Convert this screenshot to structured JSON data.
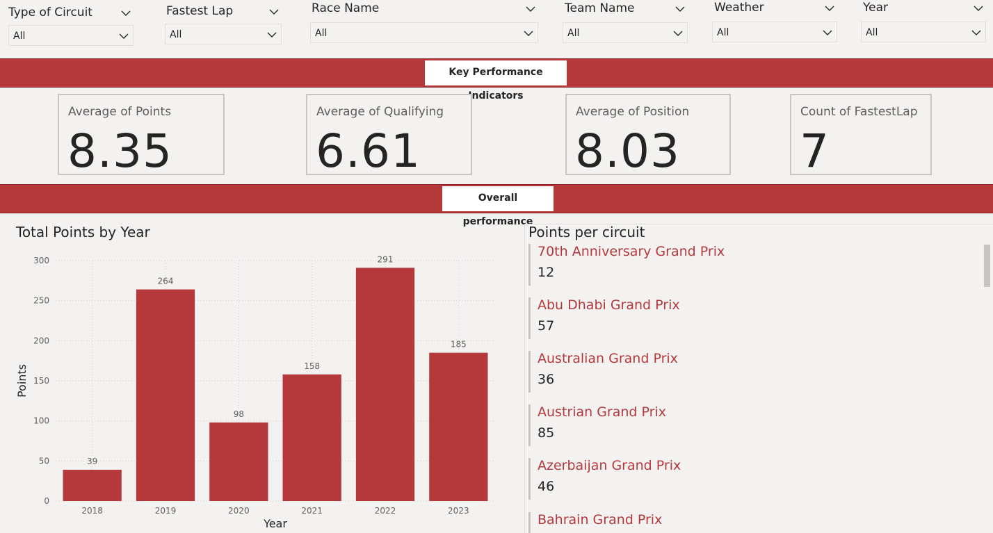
{
  "slicers": [
    {
      "title": "Type of Circuit",
      "value": "All"
    },
    {
      "title": "Fastest Lap",
      "value": "All"
    },
    {
      "title": "Race Name",
      "value": "All"
    },
    {
      "title": "Team Name",
      "value": "All"
    },
    {
      "title": "Weather",
      "value": "All"
    },
    {
      "title": "Year",
      "value": "All"
    }
  ],
  "banners": {
    "kpi_label": "Key Performance Indicators",
    "overall_label": "Overall performance"
  },
  "kpis": [
    {
      "label": "Average of Points",
      "value": "8.35"
    },
    {
      "label": "Average of Qualifying",
      "value": "6.61"
    },
    {
      "label": "Average of Position",
      "value": "8.03"
    },
    {
      "label": "Count of FastestLap",
      "value": "7"
    }
  ],
  "chart_title": "Total Points by Year",
  "list": {
    "title": "Points per circuit",
    "items": [
      {
        "name": "70th Anniversary Grand Prix",
        "points": "12"
      },
      {
        "name": "Abu Dhabi Grand Prix",
        "points": "57"
      },
      {
        "name": "Australian Grand Prix",
        "points": "36"
      },
      {
        "name": "Austrian Grand Prix",
        "points": "85"
      },
      {
        "name": "Azerbaijan Grand Prix",
        "points": "46"
      },
      {
        "name": "Bahrain Grand Prix",
        "points": ""
      }
    ]
  },
  "colors": {
    "accent": "#b5383b",
    "text": "#252423",
    "muted": "#605e5c",
    "background": "#f3f2f1"
  },
  "icons": {
    "dropdown": "chevron-down-icon"
  },
  "chart_data": {
    "type": "bar",
    "title": "Total Points by Year",
    "xlabel": "Year",
    "ylabel": "Points",
    "categories": [
      "2018",
      "2019",
      "2020",
      "2021",
      "2022",
      "2023"
    ],
    "values": [
      39,
      264,
      98,
      158,
      291,
      185
    ],
    "data_labels": [
      "39",
      "264",
      "98",
      "158",
      "291",
      "185"
    ],
    "yticks": [
      "0",
      "50",
      "100",
      "150",
      "200",
      "250",
      "300"
    ],
    "ylim": [
      0,
      300
    ],
    "grid": true,
    "color": "#b5383b"
  }
}
